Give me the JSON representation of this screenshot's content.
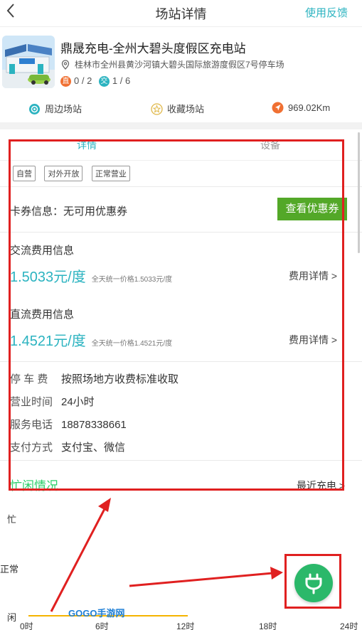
{
  "header": {
    "title": "场站详情",
    "feedback": "使用反馈",
    "back_icon": "chevron-left-icon"
  },
  "station": {
    "name": "鼎晟充电-全州大碧头度假区充电站",
    "address": "桂林市全州县黄沙河镇大碧头国际旅游度假区7号停车场",
    "dc_badge": "直",
    "dc_count": "0 / 2",
    "ac_badge": "交",
    "ac_count": "1 / 6"
  },
  "actions": {
    "nearby": "周边场站",
    "favorite": "收藏场站",
    "distance": "969.02Km"
  },
  "tabs": {
    "detail": "详情",
    "equipment": "设备"
  },
  "tags": [
    "自营",
    "对外开放",
    "正常营业"
  ],
  "coupon": {
    "label": "卡券信息：无可用优惠券",
    "button": "查看优惠券"
  },
  "ac_fee": {
    "title": "交流费用信息",
    "price": "1.5033元/度",
    "note": "全天统一价格1.5033元/度",
    "detail": "费用详情 >"
  },
  "dc_fee": {
    "title": "直流费用信息",
    "price": "1.4521元/度",
    "note": "全天统一价格1.4521元/度",
    "detail": "费用详情 >"
  },
  "info": {
    "parking_key": "停 车 费",
    "parking_val": "按照场地方收费标准收取",
    "hours_key": "营业时间",
    "hours_val": "24小时",
    "phone_key": "服务电话",
    "phone_val": "18878338661",
    "pay_key": "支付方式",
    "pay_val": "支付宝、微信"
  },
  "busy": {
    "title": "忙闲情况",
    "recent": "最近充电 >"
  },
  "chart_data": {
    "type": "line",
    "y_categories": [
      "闲",
      "正常",
      "忙"
    ],
    "x_ticks": [
      "0时",
      "6时",
      "12时",
      "18时",
      "24时"
    ],
    "x": [
      0,
      2,
      4,
      6,
      8,
      10,
      12
    ],
    "values": [
      0,
      0,
      0,
      0,
      0,
      0,
      0
    ],
    "xlim": [
      0,
      24
    ]
  },
  "watermark": "GOGO手游网",
  "colors": {
    "accent": "#2bb3c0",
    "coupon_button": "#53a828",
    "busy_title": "#2bcf6a",
    "fab": "#2bb86a",
    "annotation": "#e02020",
    "chart_line": "#f5b400"
  },
  "fab_icon": "plug-icon"
}
